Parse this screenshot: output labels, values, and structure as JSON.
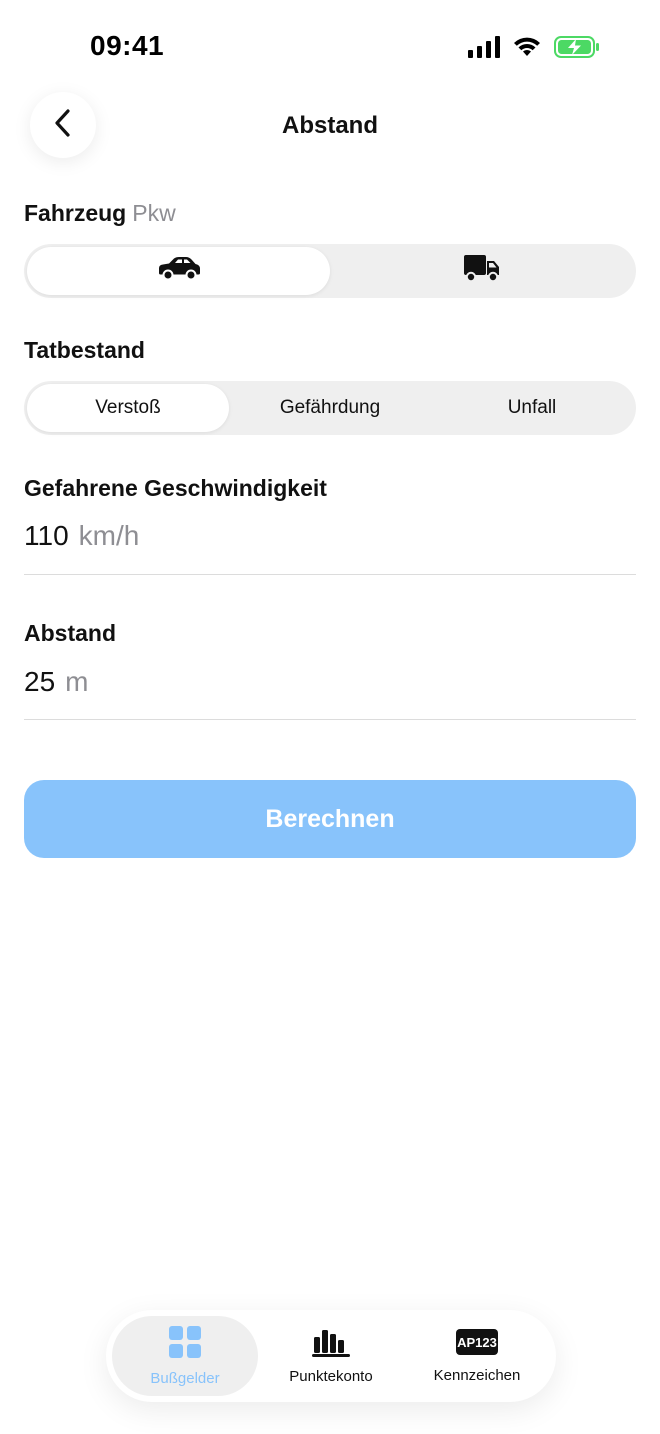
{
  "status_bar": {
    "time": "09:41",
    "icons": [
      "signal-icon",
      "wifi-icon",
      "battery-charging-icon"
    ],
    "battery_color": "#4cd964"
  },
  "header": {
    "title": "Abstand",
    "back_icon": "chevron-left-icon"
  },
  "vehicle": {
    "label": "Fahrzeug",
    "selected_value": "Pkw",
    "options": [
      {
        "icon": "car-icon",
        "active": true
      },
      {
        "icon": "truck-icon",
        "active": false
      }
    ]
  },
  "offense": {
    "label": "Tatbestand",
    "options": [
      {
        "label": "Verstoß",
        "active": true
      },
      {
        "label": "Gefährdung",
        "active": false
      },
      {
        "label": "Unfall",
        "active": false
      }
    ]
  },
  "speed": {
    "label": "Gefahrene Geschwindigkeit",
    "value": "110",
    "unit": "km/h"
  },
  "distance": {
    "label": "Abstand",
    "value": "25",
    "unit": "m"
  },
  "calculate_button": {
    "label": "Berechnen",
    "color": "#88c3fb"
  },
  "tab_bar": {
    "accent": "#88c3fb",
    "items": [
      {
        "label": "Bußgelder",
        "icon": "grid-icon",
        "active": true
      },
      {
        "label": "Punktekonto",
        "icon": "bar-chart-icon",
        "active": false
      },
      {
        "label": "Kennzeichen",
        "icon": "license-plate-icon",
        "active": false,
        "icon_text": "AP123"
      }
    ]
  }
}
